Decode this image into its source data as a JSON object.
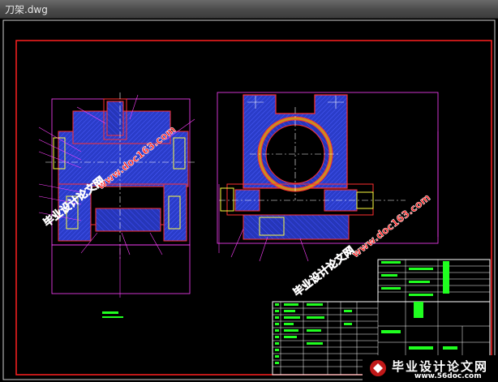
{
  "window": {
    "title": "刀架.dwg"
  },
  "watermark": {
    "text_cn": "毕业设计论文网",
    "text_url": "www.doc163.com"
  },
  "banner": {
    "title": "毕业设计论文网",
    "url": "www.56doc.com"
  },
  "colors": {
    "frame": "#ff2020",
    "hatch": "#2a3cc8",
    "part": "#ff3030",
    "dim": "#ff40ff",
    "center": "#ffffff",
    "table": "#ffffff",
    "text_green": "#20ff20",
    "watermark": "#e01818"
  }
}
